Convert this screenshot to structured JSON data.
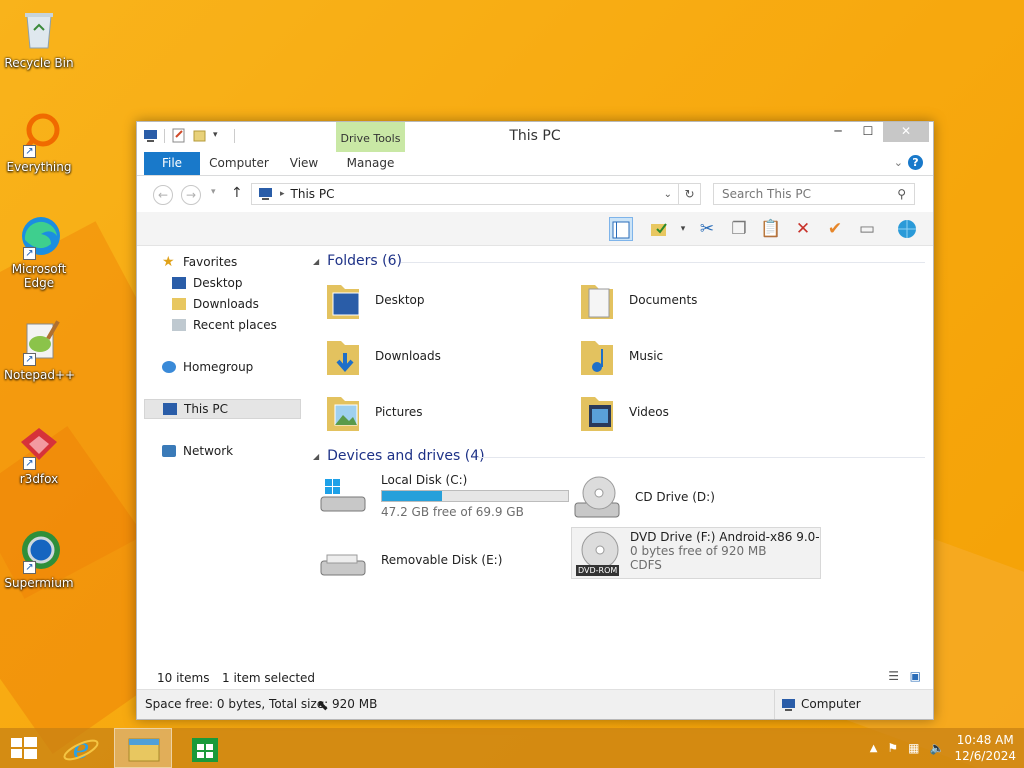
{
  "desktop": {
    "icons": [
      {
        "label": "Recycle Bin"
      },
      {
        "label": "Everything"
      },
      {
        "label": "Microsoft Edge"
      },
      {
        "label": "Notepad++"
      },
      {
        "label": "r3dfox"
      },
      {
        "label": "Supermium"
      }
    ]
  },
  "window": {
    "title": "This PC",
    "context_tab": "Drive Tools",
    "ribbon_tabs": [
      "File",
      "Computer",
      "View",
      "Manage"
    ],
    "address": "This PC",
    "search_placeholder": "Search This PC",
    "nav": {
      "favorites": "Favorites",
      "desktop": "Desktop",
      "downloads": "Downloads",
      "recent": "Recent places",
      "homegroup": "Homegroup",
      "thispc": "This PC",
      "network": "Network"
    },
    "folders_header": "Folders (6)",
    "folders": [
      "Desktop",
      "Documents",
      "Downloads",
      "Music",
      "Pictures",
      "Videos"
    ],
    "drives_header": "Devices and drives (4)",
    "drives": {
      "c": {
        "name": "Local Disk (C:)",
        "free": "47.2 GB free of 69.9 GB",
        "used_fraction": 0.32
      },
      "d": {
        "name": "CD Drive (D:)"
      },
      "e": {
        "name": "Removable Disk (E:)"
      },
      "f": {
        "name": "DVD Drive (F:) Android-x86 9.0-",
        "free": "0 bytes free of 920 MB",
        "fs": "CDFS",
        "badge": "DVD-ROM"
      }
    },
    "status": {
      "items": "10 items",
      "selected": "1 item selected"
    },
    "details": {
      "space": "Space free: 0 bytes, Total size: 920 MB",
      "location": "Computer"
    }
  },
  "taskbar": {
    "time": "10:48 AM",
    "date": "12/6/2024"
  },
  "colors": {
    "accent": "#1979ca",
    "context_tab": "#c9e8a5",
    "progress": "#26a0da"
  }
}
